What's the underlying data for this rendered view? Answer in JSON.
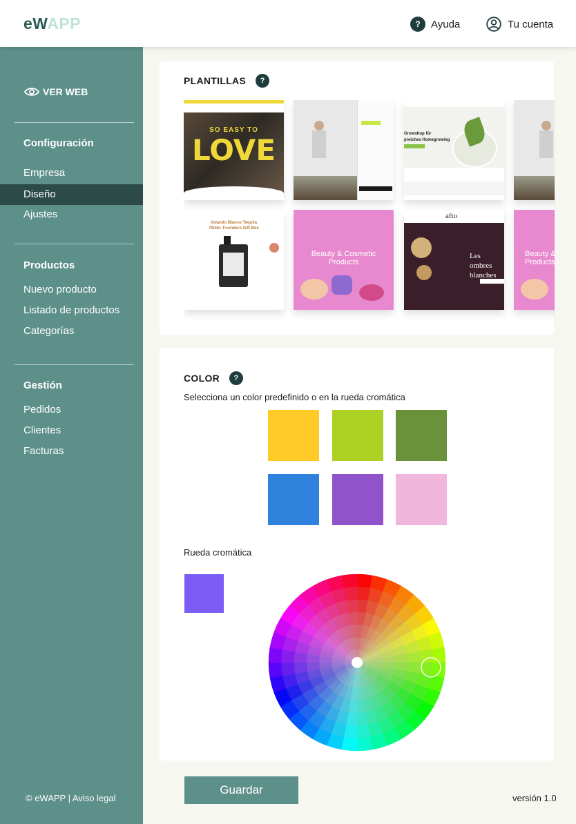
{
  "header": {
    "logo_part1": "eW",
    "logo_part2": "APP",
    "help_label": "Ayuda",
    "account_label": "Tu cuenta"
  },
  "sidebar": {
    "view_web": "VER WEB",
    "sections": [
      {
        "title": "Configuración",
        "items": [
          "Empresa",
          "Diseño",
          "Ajustes"
        ]
      },
      {
        "title": "Productos",
        "items": [
          "Nuevo producto",
          "Listado de productos",
          "Categorías"
        ]
      },
      {
        "title": "Gestión",
        "items": [
          "Pedidos",
          "Clientes",
          "Facturas"
        ]
      }
    ],
    "active_item": "Diseño",
    "footer": "© eWAPP  | Aviso legal"
  },
  "templates": {
    "title": "PLANTILLAS",
    "help_icon": "?",
    "items": [
      {
        "header_text": "SO EASY TO",
        "hero_text": "LOVE"
      },
      {
        "header_text": "",
        "hero_text": ""
      },
      {
        "header_text": "Growshop für",
        "hero_text": "preiches Homegrowing"
      },
      {
        "header_text": "",
        "hero_text": ""
      },
      {
        "header_text": "Volando Blanco Tequila",
        "hero_text": "750ml. Founders Gift Box"
      },
      {
        "header_text": "",
        "hero_text": "Beauty & Cosmetic Products"
      },
      {
        "header_text": "afto",
        "hero_text": "Les ombres blanches"
      },
      {
        "header_text": "",
        "hero_text": "Beauty & Cosmetic Products"
      }
    ]
  },
  "color": {
    "title": "COLOR",
    "help_icon": "?",
    "subtitle": "Selecciona un color predefinido o en la rueda cromática",
    "swatches": [
      "#ffc928",
      "#acd023",
      "#6a923a",
      "#2f82dc",
      "#9153ca",
      "#f0b6db"
    ],
    "wheel_label": "Rueda cromática",
    "selected_color": "#7b5cf5"
  },
  "actions": {
    "save_label": "Guardar",
    "version": "versión 1.0"
  }
}
